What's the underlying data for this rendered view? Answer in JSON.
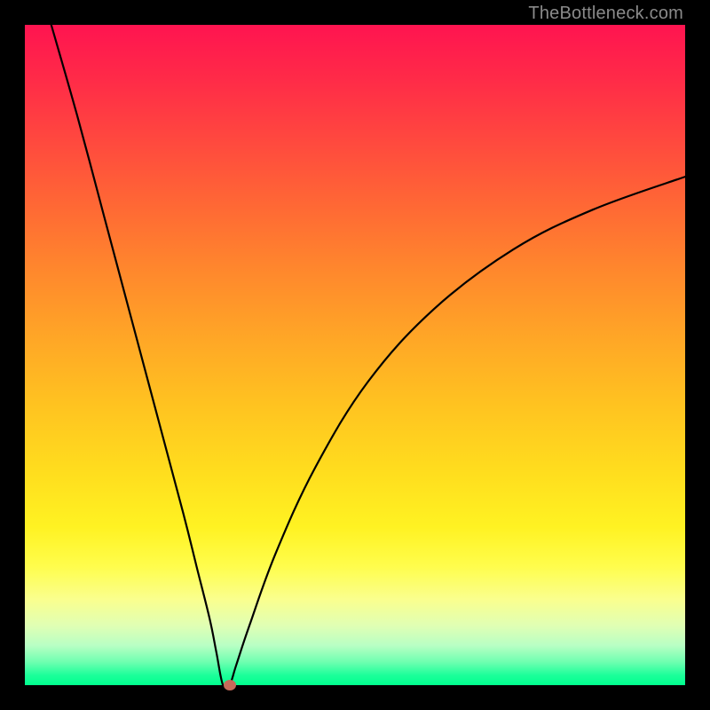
{
  "watermark": "TheBottleneck.com",
  "chart_data": {
    "type": "line",
    "title": "",
    "xlabel": "",
    "ylabel": "",
    "xlim": [
      0,
      100
    ],
    "ylim": [
      0,
      100
    ],
    "grid": false,
    "legend": false,
    "series": [
      {
        "name": "curve",
        "x": [
          4,
          8,
          12,
          16,
          20,
          24,
          26,
          28,
          29,
          30,
          31,
          32,
          34,
          38,
          44,
          52,
          62,
          74,
          86,
          100
        ],
        "y": [
          100,
          86,
          71,
          56,
          41,
          26,
          18,
          10,
          5,
          0,
          0,
          3,
          9,
          20,
          33,
          46,
          57,
          66,
          72,
          77
        ]
      }
    ],
    "marker": {
      "x": 31,
      "y": 0,
      "color": "#c76a5a"
    },
    "background_gradient": {
      "top": "#ff1450",
      "mid": "#ffde1e",
      "bottom": "#00ff8e"
    }
  }
}
